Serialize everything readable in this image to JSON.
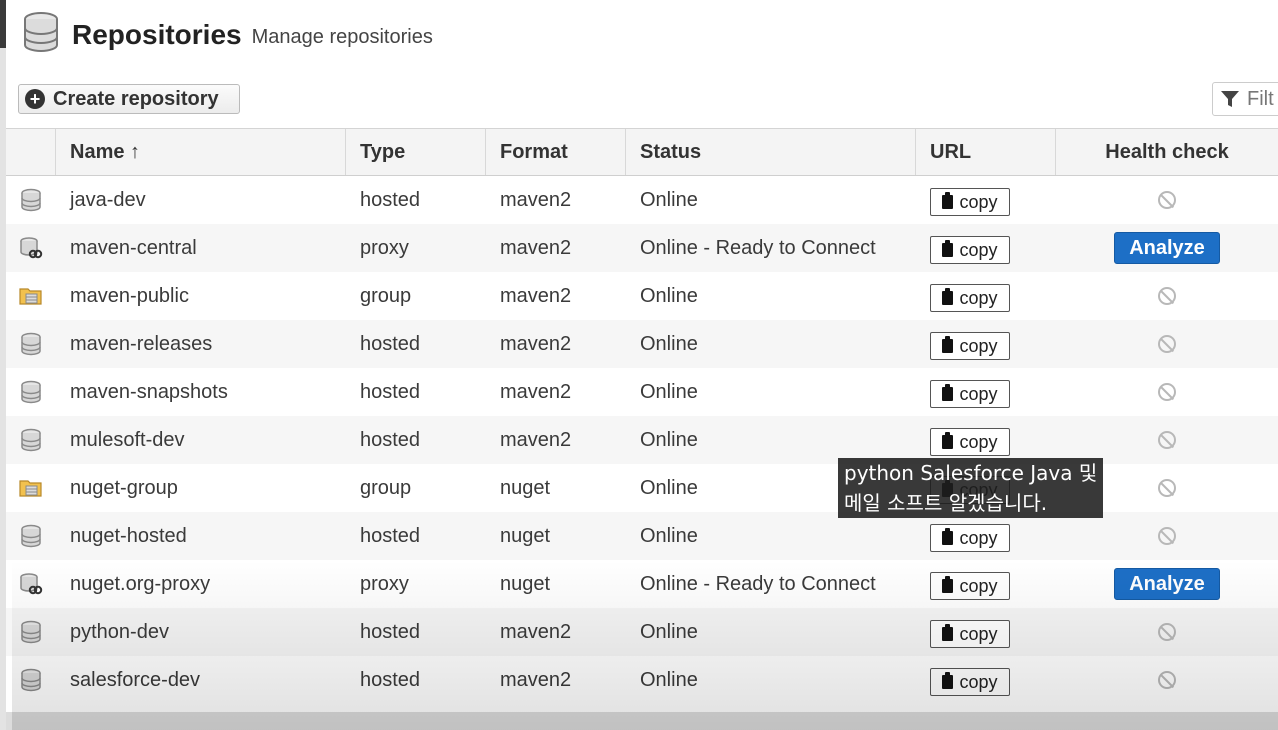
{
  "header": {
    "title": "Repositories",
    "subtitle": "Manage repositories",
    "icon": "database-icon"
  },
  "toolbar": {
    "create_label": "Create repository",
    "filter_placeholder": "Filt"
  },
  "columns": {
    "name": "Name ↑",
    "type": "Type",
    "format": "Format",
    "status": "Status",
    "url": "URL",
    "health": "Health check"
  },
  "rows": [
    {
      "icon": "database-icon",
      "name": "java-dev",
      "type": "hosted",
      "format": "maven2",
      "status": "Online",
      "url_label": "copy",
      "health": "disabled"
    },
    {
      "icon": "proxy-icon",
      "name": "maven-central",
      "type": "proxy",
      "format": "maven2",
      "status": "Online - Ready to Connect",
      "url_label": "copy",
      "health": "Analyze"
    },
    {
      "icon": "folder-icon",
      "name": "maven-public",
      "type": "group",
      "format": "maven2",
      "status": "Online",
      "url_label": "copy",
      "health": "disabled"
    },
    {
      "icon": "database-icon",
      "name": "maven-releases",
      "type": "hosted",
      "format": "maven2",
      "status": "Online",
      "url_label": "copy",
      "health": "disabled"
    },
    {
      "icon": "database-icon",
      "name": "maven-snapshots",
      "type": "hosted",
      "format": "maven2",
      "status": "Online",
      "url_label": "copy",
      "health": "disabled"
    },
    {
      "icon": "database-icon",
      "name": "mulesoft-dev",
      "type": "hosted",
      "format": "maven2",
      "status": "Online",
      "url_label": "copy",
      "health": "disabled"
    },
    {
      "icon": "folder-icon",
      "name": "nuget-group",
      "type": "group",
      "format": "nuget",
      "status": "Online",
      "url_label": "copy",
      "health": "disabled"
    },
    {
      "icon": "database-icon",
      "name": "nuget-hosted",
      "type": "hosted",
      "format": "nuget",
      "status": "Online",
      "url_label": "copy",
      "health": "disabled"
    },
    {
      "icon": "proxy-icon",
      "name": "nuget.org-proxy",
      "type": "proxy",
      "format": "nuget",
      "status": "Online - Ready to Connect",
      "url_label": "copy",
      "health": "Analyze"
    },
    {
      "icon": "database-icon",
      "name": "python-dev",
      "type": "hosted",
      "format": "maven2",
      "status": "Online",
      "url_label": "copy",
      "health": "disabled"
    },
    {
      "icon": "database-icon",
      "name": "salesforce-dev",
      "type": "hosted",
      "format": "maven2",
      "status": "Online",
      "url_label": "copy",
      "health": "disabled"
    }
  ],
  "caption": {
    "line1": "python Salesforce Java 및",
    "line2": "메일 소프트 알겠습니다."
  },
  "colors": {
    "analyze": "#1d6fc6",
    "caption_bg": "#1e1e1e"
  }
}
